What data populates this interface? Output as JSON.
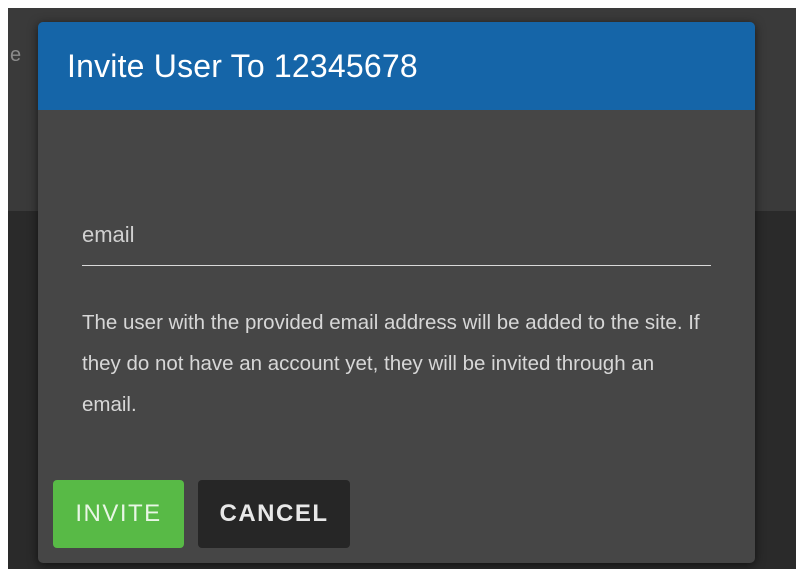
{
  "background": {
    "partial_text": "e"
  },
  "dialog": {
    "title": "Invite User To 12345678",
    "email_field": {
      "value": "",
      "placeholder": "email"
    },
    "help_text": "The user with the provided email address will be added to the site. If they do not have an account yet, they will be invited through an email.",
    "buttons": {
      "invite_label": "INVITE",
      "cancel_label": "CANCEL"
    }
  },
  "colors": {
    "header": "#1565a8",
    "dialog_bg": "#464646",
    "invite_button": "#58ba46",
    "cancel_button": "#262626"
  }
}
